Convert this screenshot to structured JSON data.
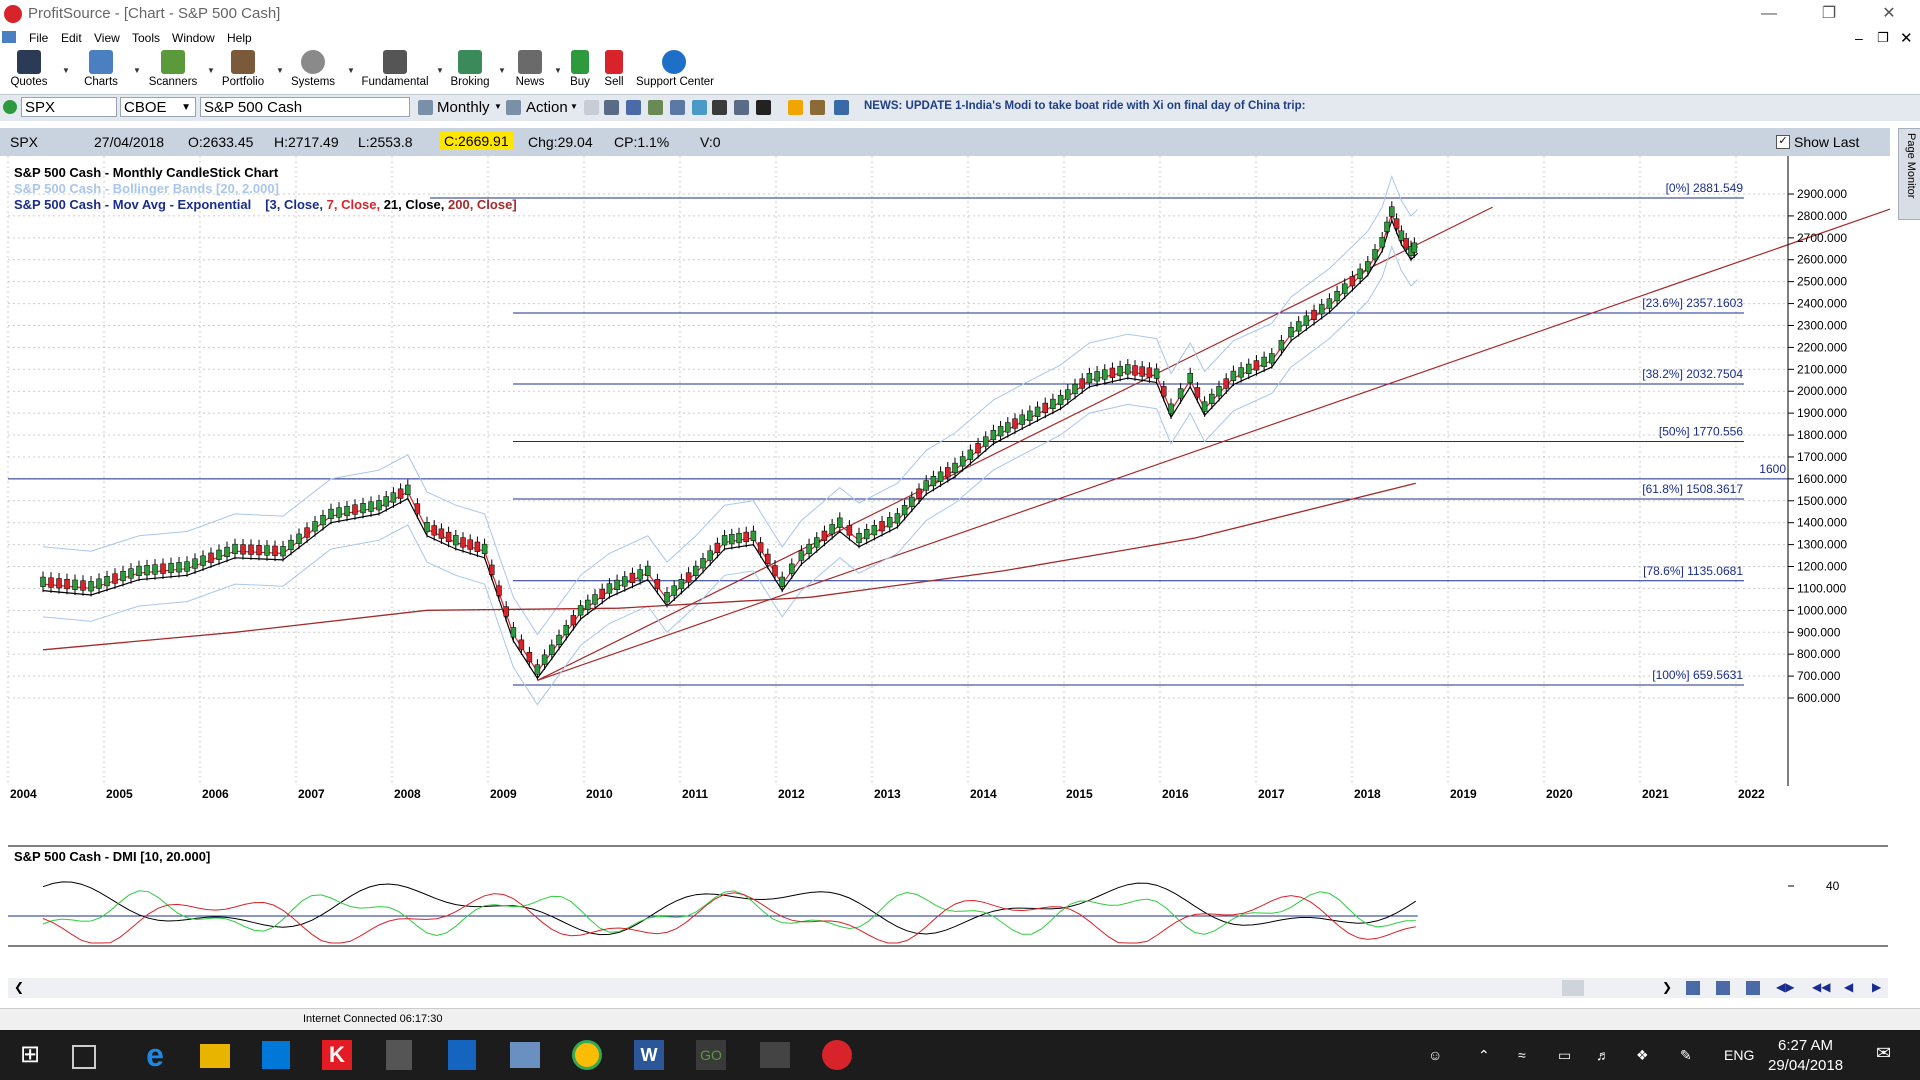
{
  "window": {
    "title": "ProfitSource - [Chart - S&P 500 Cash]"
  },
  "menu": [
    "File",
    "Edit",
    "View",
    "Tools",
    "Window",
    "Help"
  ],
  "toolbar": [
    "Quotes",
    "Charts",
    "Scanners",
    "Portfolio",
    "Systems",
    "Fundamental",
    "Broking",
    "News",
    "Buy",
    "Sell",
    "Support Center"
  ],
  "symbolbar": {
    "symbol": "SPX",
    "exchange": "CBOE",
    "name": "S&P 500 Cash",
    "period": "Monthly",
    "action": "Action",
    "news": "NEWS: UPDATE 1-India's Modi to take boat ride with Xi on final day of China trip:"
  },
  "quote": {
    "symbol": "SPX",
    "date": "27/04/2018",
    "open": "O:2633.45",
    "high": "H:2717.49",
    "low": "L:2553.8",
    "close": "C:2669.91",
    "change": "Chg:29.04",
    "cp": "CP:1.1%",
    "volume": "V:0",
    "show_last": "Show Last"
  },
  "legend": {
    "line1": "S&P 500 Cash - Monthly CandleStick Chart",
    "line2": "S&P 500 Cash - Bollinger Bands [20, 2.000]",
    "line3_prefix": "S&P 500 Cash - Mov Avg - Exponential",
    "line3_params": [
      {
        "text": "[3, Close, ",
        "color": "#1a2d8f"
      },
      {
        "text": "7, Close, ",
        "color": "#d8232a"
      },
      {
        "text": "21, Close, ",
        "color": "#000000"
      },
      {
        "text": "200, Close]",
        "color": "#a52a2a"
      }
    ]
  },
  "panels": {
    "dmi_title": "S&P 500 Cash - DMI [10, 20.000]",
    "dmi_tick": "40",
    "page_monitor": "Page Monitor"
  },
  "chart_data": {
    "type": "candlestick",
    "title": "S&P 500 Cash - Monthly CandleStick Chart",
    "ylim": [
      560,
      2960
    ],
    "y_ticks": [
      "2900.000",
      "2800.000",
      "2700.000",
      "2600.000",
      "2500.000",
      "2400.000",
      "2300.000",
      "2200.000",
      "2100.000",
      "2000.000",
      "1900.000",
      "1800.000",
      "1700.000",
      "1600.000",
      "1500.000",
      "1400.000",
      "1300.000",
      "1200.000",
      "1100.000",
      "1000.000",
      "900.000",
      "800.000",
      "700.000",
      "600.000"
    ],
    "x_ticks": [
      "2004",
      "2005",
      "2006",
      "2007",
      "2008",
      "2009",
      "2010",
      "2011",
      "2012",
      "2013",
      "2014",
      "2015",
      "2016",
      "2017",
      "2018",
      "2019",
      "2020",
      "2021",
      "2022"
    ],
    "fib_levels": [
      {
        "label": "[0%] 2881.549",
        "value": 2881.549
      },
      {
        "label": "[23.6%] 2357.1603",
        "value": 2357.1603
      },
      {
        "label": "[38.2%] 2032.7504",
        "value": 2032.7504
      },
      {
        "label": "[50%] 1770.556",
        "value": 1770.556
      },
      {
        "label": "[61.8%] 1508.3617",
        "value": 1508.3617
      },
      {
        "label": "[78.6%] 1135.0681",
        "value": 1135.0681
      },
      {
        "label": "[100%] 659.5631",
        "value": 659.5631
      }
    ],
    "horizontal_line": {
      "label": "1600",
      "value": 1600
    },
    "close_series_points": [
      [
        2004,
        1130
      ],
      [
        2004.5,
        1110
      ],
      [
        2005,
        1180
      ],
      [
        2005.5,
        1200
      ],
      [
        2006,
        1280
      ],
      [
        2006.5,
        1270
      ],
      [
        2007,
        1440
      ],
      [
        2007.5,
        1480
      ],
      [
        2007.8,
        1550
      ],
      [
        2008,
        1380
      ],
      [
        2008.3,
        1320
      ],
      [
        2008.6,
        1280
      ],
      [
        2008.9,
        900
      ],
      [
        2009.15,
        730
      ],
      [
        2009.3,
        820
      ],
      [
        2009.6,
        1000
      ],
      [
        2009.9,
        1100
      ],
      [
        2010.3,
        1180
      ],
      [
        2010.5,
        1060
      ],
      [
        2010.8,
        1180
      ],
      [
        2011.1,
        1320
      ],
      [
        2011.4,
        1340
      ],
      [
        2011.7,
        1130
      ],
      [
        2011.9,
        1250
      ],
      [
        2012.3,
        1400
      ],
      [
        2012.5,
        1330
      ],
      [
        2012.9,
        1420
      ],
      [
        2013.2,
        1570
      ],
      [
        2013.5,
        1650
      ],
      [
        2013.9,
        1800
      ],
      [
        2014.2,
        1870
      ],
      [
        2014.6,
        1960
      ],
      [
        2014.9,
        2060
      ],
      [
        2015.3,
        2100
      ],
      [
        2015.6,
        2080
      ],
      [
        2015.75,
        1920
      ],
      [
        2015.95,
        2060
      ],
      [
        2016.1,
        1930
      ],
      [
        2016.4,
        2070
      ],
      [
        2016.8,
        2150
      ],
      [
        2017.0,
        2270
      ],
      [
        2017.4,
        2400
      ],
      [
        2017.8,
        2570
      ],
      [
        2017.95,
        2680
      ],
      [
        2018.05,
        2820
      ],
      [
        2018.15,
        2710
      ],
      [
        2018.25,
        2640
      ],
      [
        2018.32,
        2670
      ]
    ],
    "dmi": {
      "ylim": [
        0,
        60
      ],
      "tick": 40,
      "threshold": 20
    }
  },
  "status": {
    "connection": "Internet Connected 06:17:30"
  },
  "taskbar": {
    "language": "ENG",
    "time": "6:27 AM",
    "date": "29/04/2018"
  }
}
